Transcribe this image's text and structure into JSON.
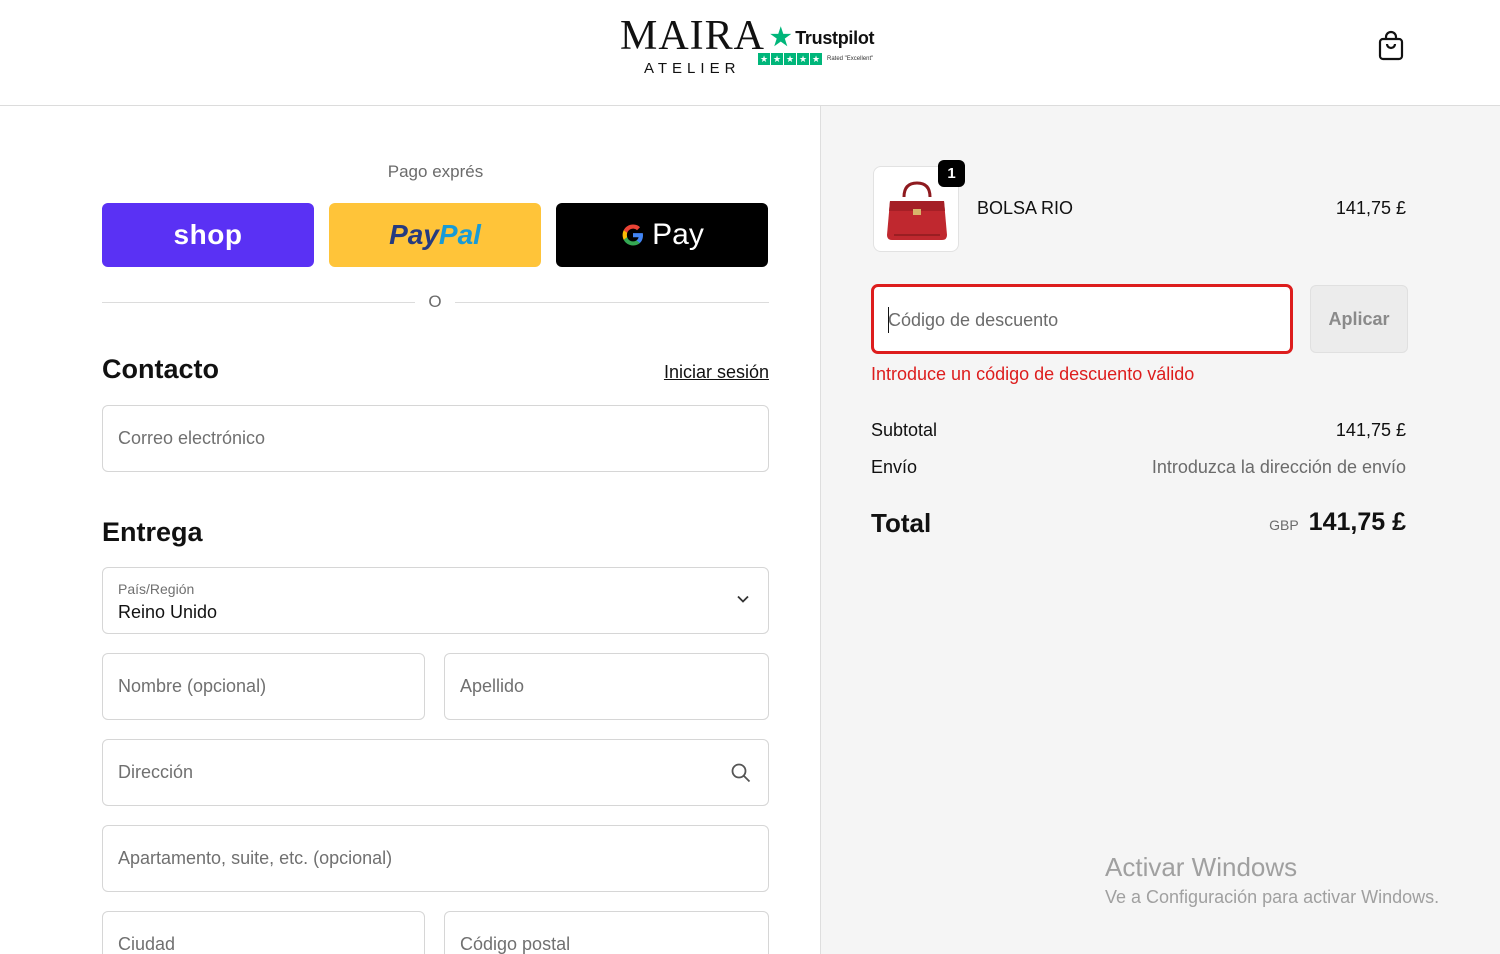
{
  "header": {
    "logo_main": "MAIRA",
    "logo_sub": "ATELIER",
    "trustpilot_name": "Trustpilot",
    "trustpilot_rated": "Rated \"Excellent\"",
    "cart_icon": "shopping-bag-icon"
  },
  "express": {
    "title": "Pago exprés",
    "shop_label": "shop",
    "paypal_label_1": "Pay",
    "paypal_label_2": "Pal",
    "gpay_label": "Pay",
    "divider_text": "O"
  },
  "contact": {
    "title": "Contacto",
    "login_link": "Iniciar sesión",
    "email_placeholder": "Correo electrónico"
  },
  "delivery": {
    "title": "Entrega",
    "country_label": "País/Región",
    "country_value": "Reino Unido",
    "first_name_placeholder": "Nombre (opcional)",
    "last_name_placeholder": "Apellido",
    "address_placeholder": "Dirección",
    "apartment_placeholder": "Apartamento, suite, etc. (opcional)",
    "city_placeholder": "Ciudad",
    "postcode_placeholder": "Código postal"
  },
  "order": {
    "item": {
      "name": "BOLSA RIO",
      "price": "141,75 £",
      "quantity": "1"
    },
    "discount_placeholder": "Código de descuento",
    "apply_label": "Aplicar",
    "error": "Introduce un código de descuento válido",
    "subtotal_label": "Subtotal",
    "subtotal_value": "141,75 £",
    "shipping_label": "Envío",
    "shipping_value": "Introduzca la dirección de envío",
    "total_label": "Total",
    "total_currency": "GBP",
    "total_value": "141,75 £"
  },
  "watermark": {
    "title": "Activar Windows",
    "subtitle": "Ve a Configuración para activar Windows."
  },
  "colors": {
    "shop": "#5a31f4",
    "paypal": "#ffc439",
    "gpay": "#000000",
    "error": "#dd1d1d",
    "trustpilot": "#00b67a"
  }
}
